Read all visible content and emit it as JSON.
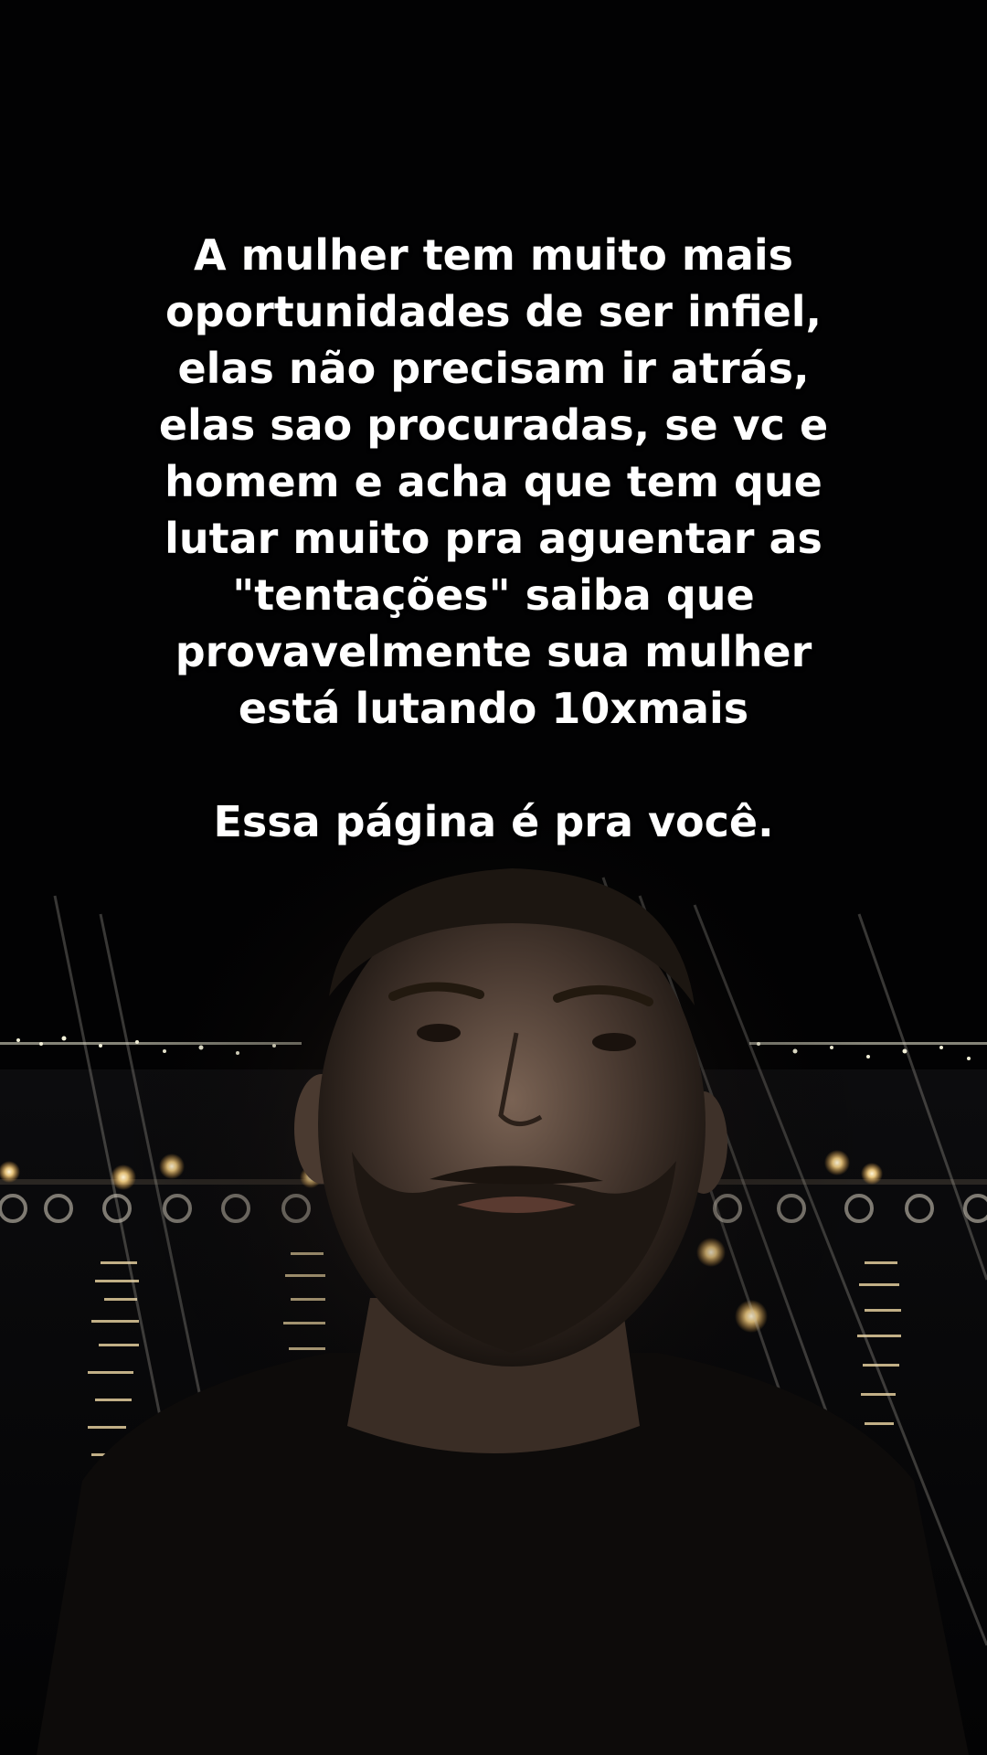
{
  "caption": {
    "lines": [
      "A mulher tem muito mais",
      "oportunidades de ser infiel,",
      "elas não precisam ir atrás,",
      "elas sao procuradas, se vc e",
      "homem e acha que tem que",
      "lutar muito pra aguentar as",
      "\"tentações\" saiba que",
      "provavelmente sua mulher",
      "está lutando 10xmais"
    ],
    "closing": "Essa página é pra você."
  },
  "colors": {
    "background": "#020203",
    "text": "#ffffff",
    "lights": "#ffe7b0"
  }
}
